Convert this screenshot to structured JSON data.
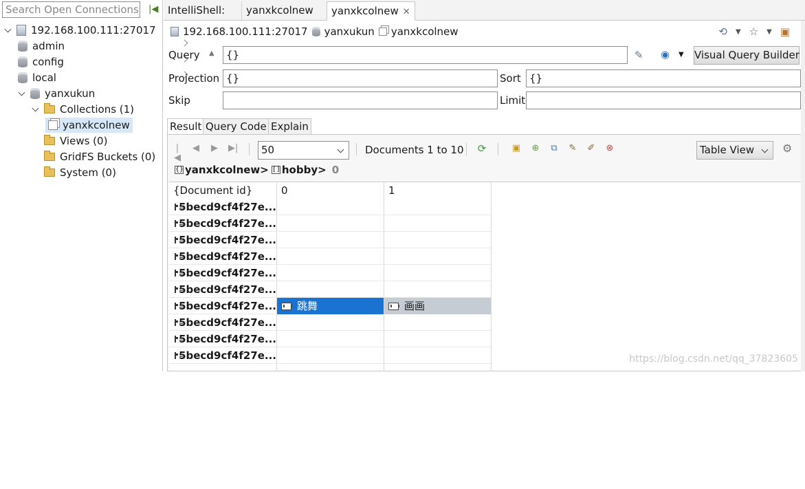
{
  "sidebar": {
    "search_placeholder": "Search Open Connections",
    "tree": {
      "server": "192.168.100.111:27017",
      "databases": [
        "admin",
        "config",
        "local",
        "yanxukun"
      ],
      "collections_label": "Collections (1)",
      "collection": "yanxkcolnew",
      "views_label": "Views (0)",
      "gridfs_label": "GridFS Buckets (0)",
      "system_label": "System (0)"
    }
  },
  "tabs": [
    {
      "label": "IntelliShell:"
    },
    {
      "label": "yanxkcolnew"
    },
    {
      "label": "yanxkcolnew",
      "close": "✕"
    }
  ],
  "breadcrumb": {
    "server": "192.168.100.111:27017",
    "database": "yanxukun",
    "collection": "yanxkcolnew"
  },
  "query": {
    "query_label": "Query",
    "query_value": "{}",
    "projection_label": "Projection",
    "projection_value": "{}",
    "sort_label": "Sort",
    "sort_value": "{}",
    "skip_label": "Skip",
    "skip_value": "",
    "limit_label": "Limit",
    "limit_value": "",
    "vqb_label": "Visual Query Builder"
  },
  "result_tabs": [
    "Result",
    "Query Code",
    "Explain"
  ],
  "toolbar": {
    "page_size": "50",
    "documents_label": "Documents 1 to 10",
    "view_mode": "Table View"
  },
  "path": {
    "collection": "yanxkcolnew",
    "sep1": ">",
    "field": "hobby",
    "sep2": ">",
    "index": "0"
  },
  "grid": {
    "headers": [
      "{Document id}",
      "0",
      "1"
    ],
    "rows": [
      {
        "id": "5becd9cf4f27e...",
        "c0": "",
        "c1": ""
      },
      {
        "id": "5becd9cf4f27e...",
        "c0": "",
        "c1": ""
      },
      {
        "id": "5becd9cf4f27e...",
        "c0": "",
        "c1": ""
      },
      {
        "id": "5becd9cf4f27e...",
        "c0": "",
        "c1": ""
      },
      {
        "id": "5becd9cf4f27e...",
        "c0": "",
        "c1": ""
      },
      {
        "id": "5becd9cf4f27e...",
        "c0": "",
        "c1": ""
      },
      {
        "id": "5becd9cf4f27e...",
        "c0": "跳舞",
        "c1": "画画",
        "selected": true
      },
      {
        "id": "5becd9cf4f27e...",
        "c0": "",
        "c1": ""
      },
      {
        "id": "5becd9cf4f27e...",
        "c0": "",
        "c1": ""
      },
      {
        "id": "5becd9cf4f27e...",
        "c0": "",
        "c1": ""
      }
    ]
  },
  "watermark": "https://blog.csdn.net/qq_37823605",
  "colors": {
    "selection": "#1a73d1",
    "tree_selection": "#d6e8f7"
  }
}
